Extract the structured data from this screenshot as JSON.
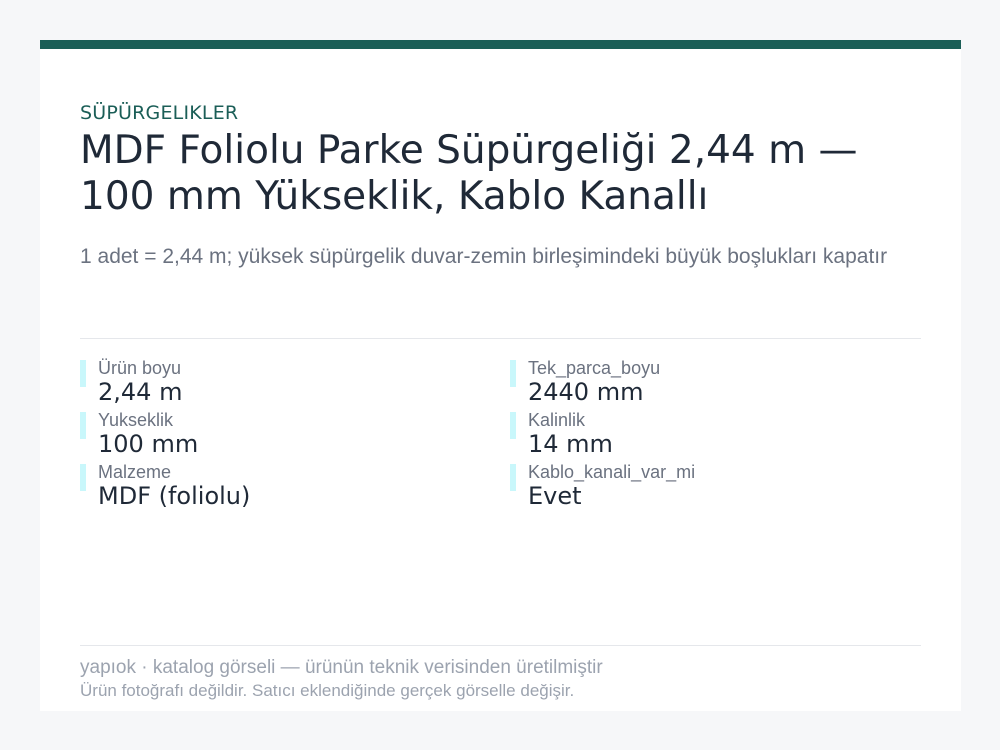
{
  "header": {
    "category": "SÜPÜRGELIKLER",
    "title": "MDF Foliolu Parke Süpürgeliği 2,44 m — 100 mm Yükseklik, Kablo Kanallı",
    "subtitle": "1 adet = 2,44 m; yüksek süpürgelik duvar-zemin birleşimindeki büyük boşlukları kapatır"
  },
  "specs": [
    {
      "label": "Ürün boyu",
      "value": "2,44 m"
    },
    {
      "label": "Tek_parca_boyu",
      "value": "2440 mm"
    },
    {
      "label": "Yukseklik",
      "value": "100 mm"
    },
    {
      "label": "Kalinlik",
      "value": "14 mm"
    },
    {
      "label": "Malzeme",
      "value": "MDF (foliolu)"
    },
    {
      "label": "Kablo_kanali_var_mi",
      "value": "Evet"
    }
  ],
  "footer": {
    "line1": "yapıok · katalog görseli — ürünün teknik verisinden üretilmiştir",
    "line2": "Ürün fotoğrafı değildir. Satıcı eklendiğinde gerçek görselle değişir."
  },
  "colors": {
    "accent": "#1b5e57",
    "spec_marker": "#c9f7fb",
    "background": "#f6f7f9"
  }
}
